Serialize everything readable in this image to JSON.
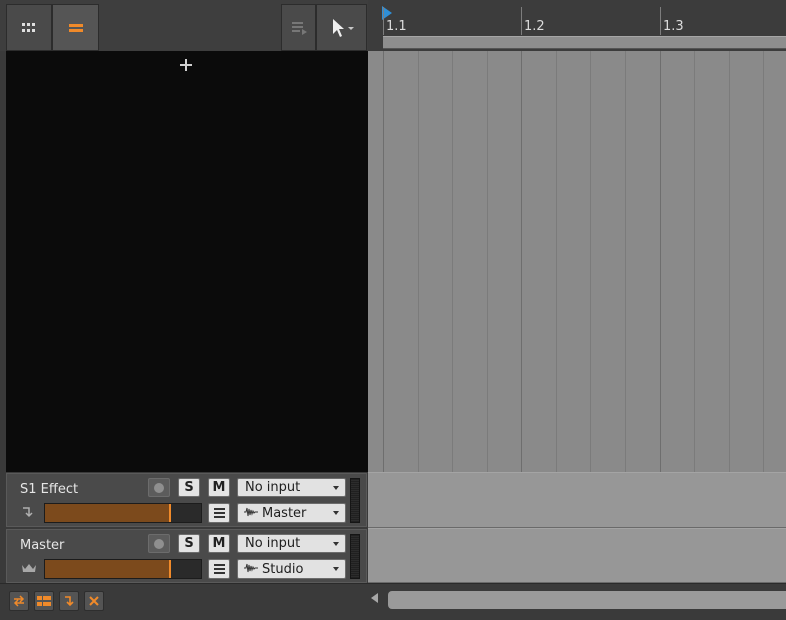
{
  "toolbar": {
    "ruler": {
      "labels": [
        "1.1",
        "1.2",
        "1.3"
      ]
    }
  },
  "tracks": [
    {
      "name": "S1 Effect",
      "solo": "S",
      "mute": "M",
      "input": "No input",
      "output": "Master",
      "fader_level": 0.8
    },
    {
      "name": "Master",
      "solo": "S",
      "mute": "M",
      "input": "No input",
      "output": "Studio",
      "fader_level": 0.8
    }
  ],
  "colors": {
    "accent": "#f08a2a",
    "fader_fill": "#7c4a1c",
    "playhead": "#2f8fd6"
  },
  "icons": [
    "grid-view-icon",
    "list-view-icon",
    "arranger-icon",
    "pointer-tool-icon",
    "add-icon",
    "return-arrow-icon",
    "crown-icon",
    "waveform-icon"
  ]
}
